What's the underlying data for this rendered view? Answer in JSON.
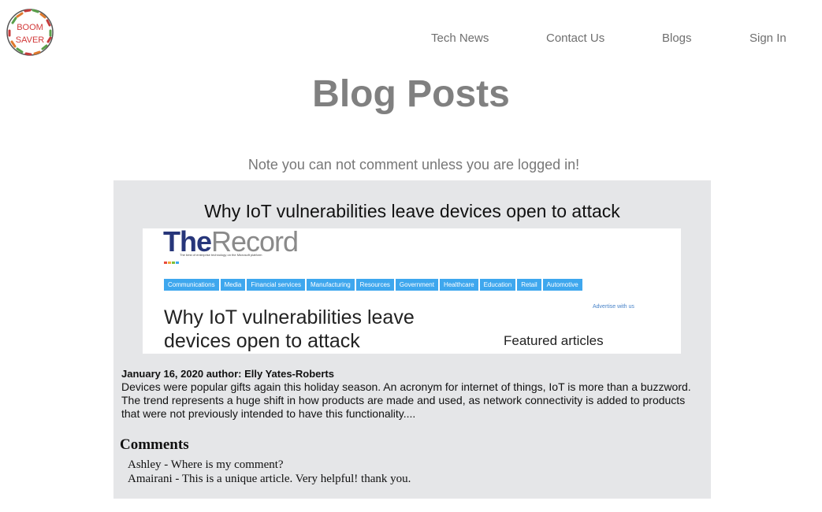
{
  "logo": {
    "line1": "BOOM",
    "line2": "SAVER"
  },
  "nav": [
    {
      "label": "Tech News"
    },
    {
      "label": "Contact Us"
    },
    {
      "label": "Blogs"
    },
    {
      "label": "Sign In"
    }
  ],
  "page_title": "Blog Posts",
  "note": "Note you can not comment unless you are logged in!",
  "post": {
    "title": "Why IoT vulnerabilities leave devices open to attack",
    "image": {
      "brand_the": "The",
      "brand_record": "Record",
      "tagline": "The best of enterprise technology on the Microsoft platform",
      "categories": [
        "Communications",
        "Media",
        "Financial services",
        "Manufacturing",
        "Resources",
        "Government",
        "Healthcare",
        "Education",
        "Retail",
        "Automotive"
      ],
      "advertise": "Advertise with us",
      "headline_line1": "Why IoT vulnerabilities leave",
      "headline_line2": "devices open to attack",
      "featured": "Featured articles",
      "dot_colors": [
        "#e84b3c",
        "#f2a93b",
        "#7bbf3b",
        "#3ea7ee"
      ]
    },
    "meta": "January 16, 2020 author: Elly Yates-Roberts",
    "excerpt": "Devices were popular gifts again this holiday season. An acronym for internet of things, IoT is more than a buzzword. The trend represents a huge shift in how products are made and used, as network connectivity is added to products that were not previously intended to have this functionality...."
  },
  "comments": {
    "heading": "Comments",
    "items": [
      "Ashley - Where is my comment?",
      "Amairani - This is a unique article. Very helpful! thank you."
    ]
  },
  "colors": {
    "card_bg": "#e5e6e8",
    "category_blue": "#3ea7ee",
    "nav_text": "#6f6f6f",
    "title_gray": "#808080"
  }
}
